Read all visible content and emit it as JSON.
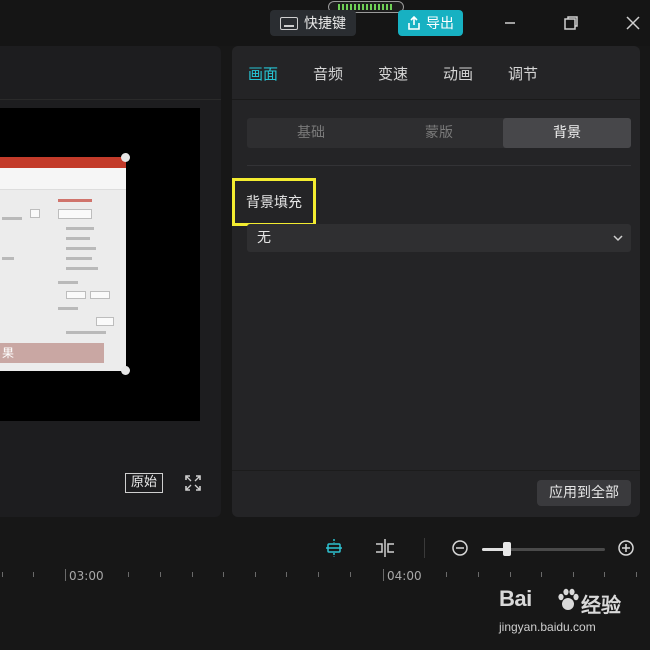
{
  "titlebar": {
    "shortcut_label": "快捷键",
    "export_label": "导出",
    "icons": [
      "keyboard-icon",
      "export-icon",
      "minimize-icon",
      "restore-icon",
      "close-icon"
    ],
    "export_color": "#17b1c2"
  },
  "player": {
    "caption_text": "果",
    "original_label": "原始"
  },
  "properties": {
    "tabs": [
      {
        "label": "画面",
        "active": true
      },
      {
        "label": "音频",
        "active": false
      },
      {
        "label": "变速",
        "active": false
      },
      {
        "label": "动画",
        "active": false
      },
      {
        "label": "调节",
        "active": false
      }
    ],
    "subtabs": [
      {
        "label": "基础",
        "active": false
      },
      {
        "label": "蒙版",
        "active": false
      },
      {
        "label": "背景",
        "active": true
      }
    ],
    "section_label": "背景填充",
    "fill_select_value": "无",
    "apply_all_label": "应用到全部",
    "accent_color": "#26c4d4",
    "highlight_color": "#f3ec30"
  },
  "timeline": {
    "zoom_level": 0.2,
    "time_labels": [
      "03:00",
      "04:00"
    ]
  },
  "watermark": {
    "brand_prefix": "Bai",
    "brand_suffix": "经验",
    "url": "jingyan.baidu.com"
  }
}
